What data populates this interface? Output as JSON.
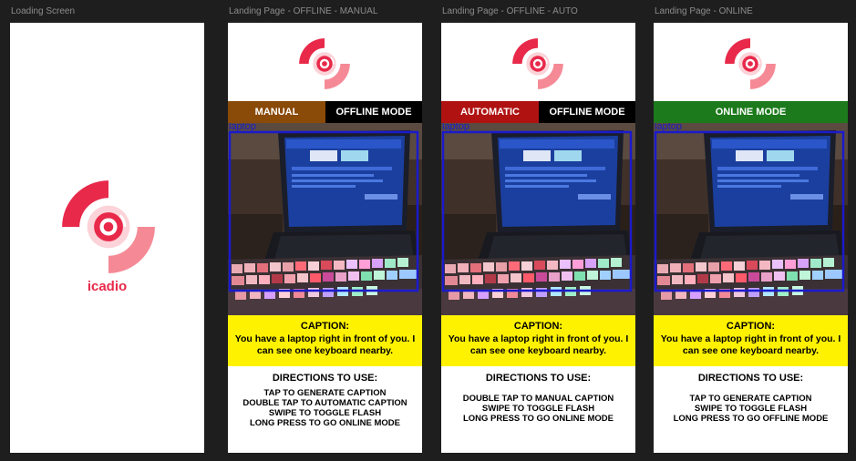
{
  "colors": {
    "background": "#1e1e1e",
    "brand": "#e8294a",
    "brand_light": "#f58a96",
    "manual": "#8a4a08",
    "automatic": "#b01212",
    "offline": "#000000",
    "online": "#1c7a1c",
    "caption_bg": "#fff200",
    "detection_box": "#1a1acc"
  },
  "frames": [
    {
      "title": "Loading Screen",
      "brand": "icadio",
      "logo_icon": "icadio-logo-icon"
    },
    {
      "title": "Landing Page - OFFLINE - MANUAL",
      "logo_icon": "icadio-logo-icon",
      "modes": [
        "MANUAL",
        "OFFLINE MODE"
      ],
      "detection_label": "laptop",
      "caption_title": "CAPTION:",
      "caption_text": "You have a laptop right in front of you. I can see one keyboard nearby.",
      "directions_title": "DIRECTIONS TO USE:",
      "directions": [
        "TAP TO GENERATE CAPTION",
        "DOUBLE TAP TO AUTOMATIC CAPTION",
        "SWIPE TO TOGGLE FLASH",
        "LONG PRESS TO GO ONLINE MODE"
      ]
    },
    {
      "title": "Landing Page - OFFLINE - AUTO",
      "logo_icon": "icadio-logo-icon",
      "modes": [
        "AUTOMATIC",
        "OFFLINE MODE"
      ],
      "detection_label": "laptop",
      "caption_title": "CAPTION:",
      "caption_text": "You have a laptop right in front of you. I can see one keyboard nearby.",
      "directions_title": "DIRECTIONS TO USE:",
      "directions": [
        "DOUBLE TAP TO MANUAL CAPTION",
        "SWIPE TO TOGGLE FLASH",
        "LONG PRESS TO GO ONLINE MODE"
      ]
    },
    {
      "title": "Landing Page - ONLINE",
      "logo_icon": "icadio-logo-icon",
      "modes": [
        "ONLINE MODE"
      ],
      "detection_label": "laptop",
      "caption_title": "CAPTION:",
      "caption_text": "You have a laptop right in front of you. I can see one keyboard nearby.",
      "directions_title": "DIRECTIONS TO USE:",
      "directions": [
        "TAP TO GENERATE CAPTION",
        "SWIPE TO TOGGLE FLASH",
        "LONG PRESS TO GO OFFLINE MODE"
      ]
    }
  ]
}
